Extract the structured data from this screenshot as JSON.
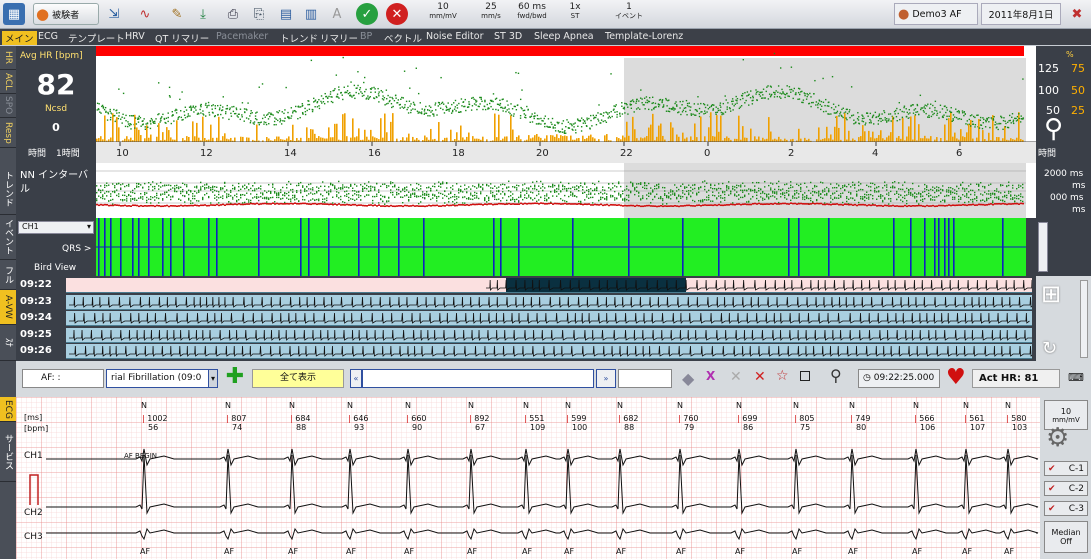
{
  "toolbar": {
    "user_button_label": "被験者",
    "speed_value": "10",
    "speed_unit": "mm/mV",
    "paper_value": "25",
    "paper_unit": "mm/s",
    "interval_value": "60 ms",
    "interval_unit": "fwd/bwd",
    "zoom_value": "1x",
    "zoom_unit": "ST",
    "event_value": "1",
    "event_unit": "イベント",
    "user_name": "Demo3 AF",
    "date": "2011年8月1日"
  },
  "menu": {
    "items": [
      "メイン",
      "ECG",
      "テンプレート",
      "HRV",
      "QT リマリー",
      "Pacemaker",
      "トレンド",
      "リマリー",
      "BP",
      "ベクトル",
      "Noise Editor",
      "ST 3D",
      "Sleep Apnea",
      "Template-Lorenz"
    ]
  },
  "left_tabs": [
    "HR",
    "ACL",
    "SPO",
    "Resp",
    "トレンド",
    "イベント",
    "フル",
    "A-VW",
    "ｽﾅ",
    "ECG",
    "サービス"
  ],
  "hr_panel": {
    "title": "Avg HR [bpm]",
    "hr_value": "82",
    "ncsd_label": "Ncsd",
    "ncsd_value": "0",
    "time_label": "時間",
    "span_label": "1時間",
    "time_ticks": [
      "10",
      "12",
      "14",
      "16",
      "18",
      "20",
      "22",
      "0",
      "2",
      "4",
      "6"
    ],
    "right_ticks": [
      "125",
      "100",
      "50"
    ],
    "right_ticks_orange": [
      "%",
      "75",
      "50",
      "25"
    ],
    "right_time": "時間"
  },
  "nn_panel": {
    "title": "NN インターバル",
    "right_ticks": [
      "2000 ms",
      "ms",
      "000 ms",
      "ms"
    ]
  },
  "qrs_panel": {
    "channel": "CH1",
    "qrs_label": "QRS >",
    "view_label": "Bird View"
  },
  "rhythm_rows": [
    "09:22",
    "09:23",
    "09:24",
    "09:25",
    "09:26"
  ],
  "control_bar": {
    "af_label": "AF: :",
    "rhythm_select": "rial Fibrillation (09:0",
    "show_all": "全て表示",
    "time_value": "09:22:25.000",
    "act_hr": "Act HR: 81"
  },
  "ecg": {
    "unit_ms": "[ms]",
    "unit_bpm": "[bpm]",
    "ch1": "CH1",
    "ch2": "CH2",
    "ch3": "CH3",
    "af_begin": "AF BEGIN",
    "beats": [
      {
        "rr": "1002",
        "hr": "56"
      },
      {
        "rr": "807",
        "hr": "74"
      },
      {
        "rr": "684",
        "hr": "88"
      },
      {
        "rr": "646",
        "hr": "93"
      },
      {
        "rr": "660",
        "hr": "90"
      },
      {
        "rr": "892",
        "hr": "67"
      },
      {
        "rr": "551",
        "hr": "109"
      },
      {
        "rr": "599",
        "hr": "100"
      },
      {
        "rr": "682",
        "hr": "88"
      },
      {
        "rr": "760",
        "hr": "79"
      },
      {
        "rr": "699",
        "hr": "86"
      },
      {
        "rr": "805",
        "hr": "75"
      },
      {
        "rr": "749",
        "hr": "80"
      },
      {
        "rr": "566",
        "hr": "106"
      },
      {
        "rr": "561",
        "hr": "107"
      },
      {
        "rr": "580",
        "hr": "103"
      }
    ],
    "beat_label": "N",
    "af_marker": "AF"
  },
  "ecg_side": {
    "gain": "10",
    "gain_unit": "mm/mV",
    "ch_labels": [
      "C-1",
      "C-2",
      "C-3"
    ],
    "median": "Median",
    "median_state": "Off"
  },
  "colors": {
    "hr_green": "#1a8a1a",
    "bar_orange": "#f0a000",
    "alarm_red": "#ff0000",
    "qrs_green": "#22ee22",
    "qrs_blue": "#1020c0",
    "rhythm_bg": "#a9cfe0"
  }
}
